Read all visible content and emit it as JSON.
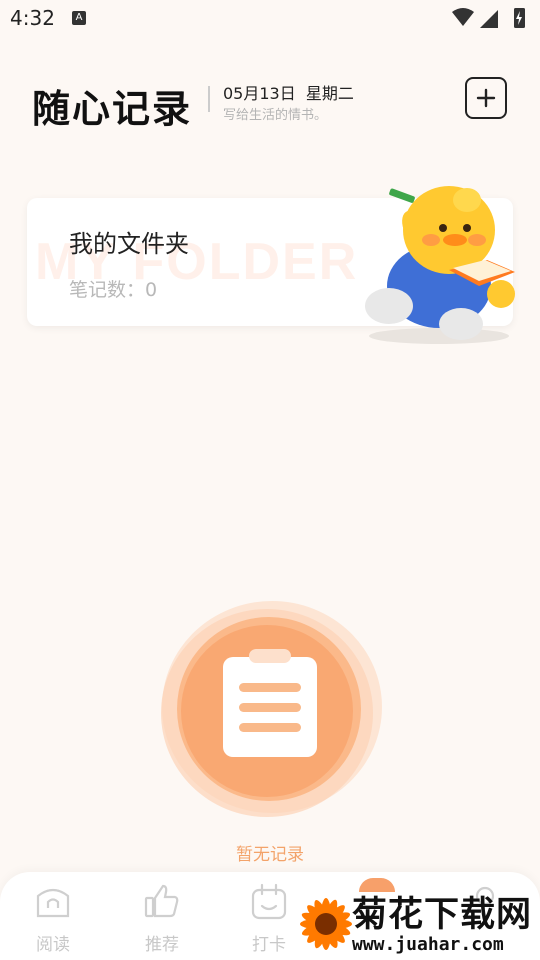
{
  "status_bar": {
    "time": "4:32",
    "notification_icon_letter": "A",
    "icons": [
      "wifi-icon",
      "signal-icon",
      "battery-charging-icon"
    ]
  },
  "header": {
    "app_title": "随心记录",
    "date": "05月13日  星期二",
    "slogan": "写给生活的情书。",
    "add_button_label": "+"
  },
  "folder_card": {
    "watermark": "MY FOLDER",
    "title": "我的文件夹",
    "count_label": "笔记数：",
    "count_value": "0"
  },
  "empty_state": {
    "text": "暂无记录"
  },
  "tabbar": {
    "items": [
      {
        "label": "阅读",
        "icon": "home-icon",
        "active": false
      },
      {
        "label": "推荐",
        "icon": "thumbs-up-icon",
        "active": false
      },
      {
        "label": "打卡",
        "icon": "checkin-icon",
        "active": false
      },
      {
        "label": "",
        "icon": "notes-icon",
        "active": true
      },
      {
        "label": "",
        "icon": "profile-icon",
        "active": false
      }
    ]
  },
  "watermark": {
    "title": "菊花下载网",
    "url": "www.juahar.com"
  },
  "colors": {
    "accent": "#f7a06a",
    "background": "#fdf8f4",
    "muted_text": "#b8b8b8"
  }
}
